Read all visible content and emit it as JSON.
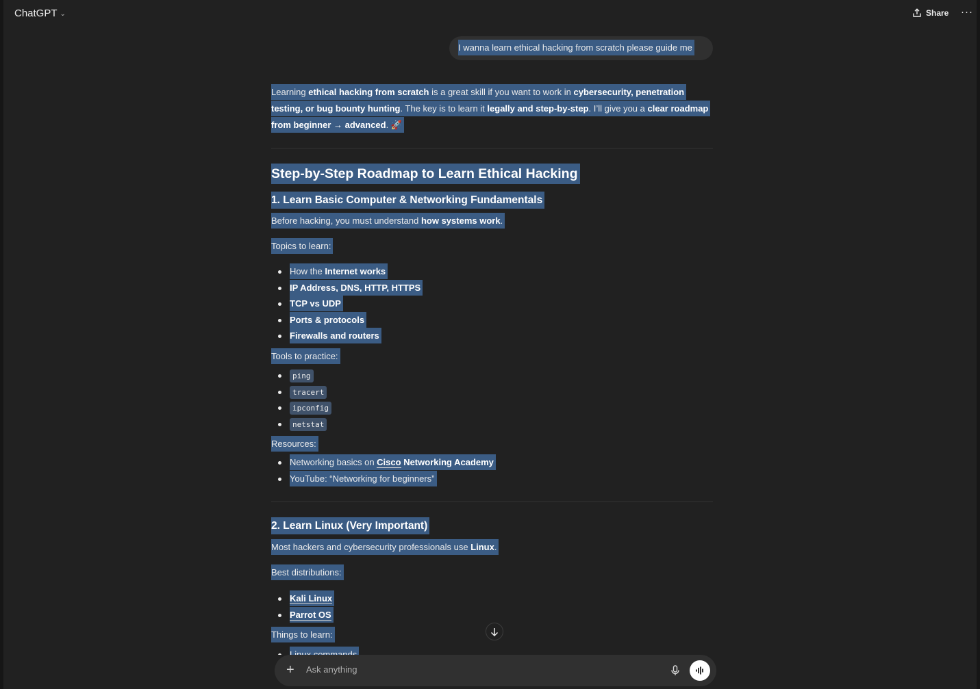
{
  "header": {
    "model_name": "ChatGPT",
    "share_label": "Share",
    "more_label": "···"
  },
  "user_message": "I wanna learn ethical hacking from scratch please guide me",
  "assistant": {
    "intro": {
      "t1": "Learning ",
      "b1": "ethical hacking from scratch",
      "t2": " is a great skill if you want to work in ",
      "b2": "cybersecurity, penetration testing, or bug bounty hunting",
      "t3": ". The key is to learn it ",
      "b3": "legally and step-by-step",
      "t4": ". I’ll give you a ",
      "b4": "clear roadmap from beginner → advanced",
      "t5": ". 🚀"
    },
    "roadmap_title": "Step-by-Step Roadmap to Learn Ethical Hacking",
    "section1": {
      "title": "1. Learn Basic Computer & Networking Fundamentals",
      "lead_text": "Before hacking, you must understand ",
      "lead_bold": "how systems work",
      "lead_end": ".",
      "topics_label": "Topics to learn:",
      "topics": [
        {
          "plain": "How the ",
          "bold": "Internet works"
        },
        {
          "plain": "",
          "bold": "IP Address, DNS, HTTP, HTTPS"
        },
        {
          "plain": "",
          "bold": "TCP vs UDP"
        },
        {
          "plain": "",
          "bold": "Ports & protocols"
        },
        {
          "plain": "",
          "bold": "Firewalls and routers"
        }
      ],
      "tools_label": "Tools to practice:",
      "tools": [
        "ping",
        "tracert",
        "ipconfig",
        "netstat"
      ],
      "resources_label": "Resources:",
      "resource1_plain": "Networking basics on ",
      "resource1_link": "Cisco",
      "resource1_bold": " Networking Academy",
      "resource2": "YouTube: “Networking for beginners”"
    },
    "section2": {
      "title": "2. Learn Linux (Very Important)",
      "lead_text": "Most hackers and cybersecurity professionals use ",
      "lead_bold": "Linux",
      "lead_end": ".",
      "distros_label": "Best distributions:",
      "distros": [
        "Kali Linux",
        "Parrot OS"
      ],
      "things_label": "Things to learn:",
      "things_first": "Linux commands"
    }
  },
  "composer": {
    "placeholder": "Ask anything"
  }
}
